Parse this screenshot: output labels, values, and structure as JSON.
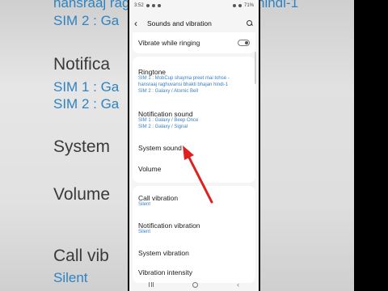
{
  "background_left": {
    "line1": "hansraaj raghuvansi bhakti b",
    "line2": "SIM 2 : Ga",
    "line3": "Notifica",
    "line4": "SIM 1 : Ga",
    "line5": "SIM 2 : Ga",
    "line6": "System",
    "line7": "Volume",
    "line8": "Call vib",
    "line9": "Silent"
  },
  "background_right": {
    "line1": "hindi-1"
  },
  "status_bar": {
    "time": "3:52",
    "battery": "71%"
  },
  "app_bar": {
    "title": "Sounds and vibration"
  },
  "settings": {
    "vibrate_while_ringing": "Vibrate while ringing",
    "ringtone": {
      "title": "Ringtone",
      "sub1": "SIM 1 : MobCup shayma preet mai tohse -",
      "sub2": "hansraaj raghuvansi bhakti bhajan hindi-1",
      "sub3": "SIM 2 : Galaxy / Atomic Bell"
    },
    "notification_sound": {
      "title": "Notification sound",
      "sub1": "SIM 1 : Galaxy / Beep Once",
      "sub2": "SIM 2 : Galaxy / Signal"
    },
    "system_sound": "System sound",
    "volume": "Volume",
    "call_vibration": {
      "title": "Call vibration",
      "sub": "Silent"
    },
    "notification_vibration": {
      "title": "Notification vibration",
      "sub": "Silent"
    },
    "system_vibration": "System vibration",
    "vibration_intensity": "Vibration intensity"
  },
  "colors": {
    "accent_blue": "#3a7fc0",
    "arrow_red": "#e02020"
  }
}
